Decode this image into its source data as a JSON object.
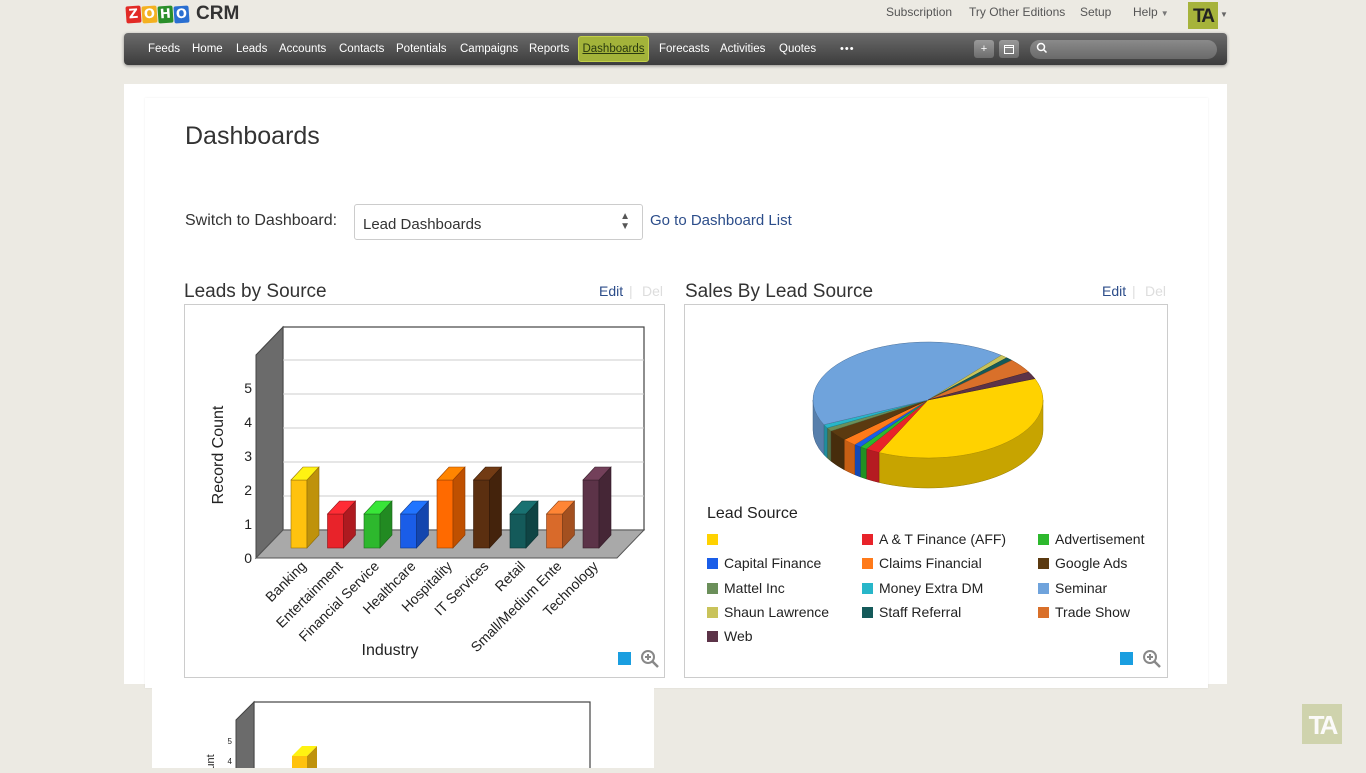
{
  "app": {
    "logo_letters": [
      "Z",
      "O",
      "H",
      "O"
    ],
    "logo_colors": [
      "#e22b26",
      "#f4b120",
      "#2a8f2a",
      "#2a6fd1"
    ],
    "product": "CRM",
    "avatar_initials": "TA"
  },
  "top_links": [
    "Subscription",
    "Try Other Editions",
    "Setup",
    "Help"
  ],
  "nav": {
    "items": [
      "Feeds",
      "Home",
      "Leads",
      "Accounts",
      "Contacts",
      "Potentials",
      "Campaigns",
      "Reports",
      "Dashboards",
      "Forecasts",
      "Activities",
      "Quotes"
    ],
    "active": "Dashboards",
    "more": "•••",
    "add_icon": "+",
    "calendar_icon": "calendar-icon",
    "search_placeholder": ""
  },
  "page": {
    "title": "Dashboards",
    "switch_label": "Switch to Dashboard:",
    "selected_dashboard": "Lead Dashboards",
    "goto_link": "Go to Dashboard List"
  },
  "widgets": [
    {
      "title": "Leads by Source",
      "edit": "Edit",
      "sep": "|",
      "del": "Del"
    },
    {
      "title": "Sales By Lead Source",
      "edit": "Edit",
      "sep": "|",
      "del": "Del"
    }
  ],
  "chart_data": [
    {
      "type": "bar",
      "title": "",
      "xlabel": "Industry",
      "ylabel": "Record Count",
      "categories": [
        "Banking",
        "Entertainment",
        "Financial Service",
        "Healthcare",
        "Hospitality",
        "IT Services",
        "Retail",
        "Small/Medium Ente",
        "Technology"
      ],
      "values": [
        2,
        1,
        1,
        1,
        2,
        2,
        1,
        1,
        2
      ],
      "colors": [
        "#ffc20e",
        "#e8232a",
        "#2db82d",
        "#1a5de8",
        "#ff6a00",
        "#5b2f10",
        "#145a5a",
        "#d96a2a",
        "#5c3348"
      ],
      "ylim": [
        0,
        5
      ],
      "yticks": [
        "0",
        "1",
        "2",
        "3",
        "4",
        "5"
      ],
      "grid": true
    },
    {
      "type": "pie",
      "title": "",
      "legend_title": "Lead Source",
      "legend_placement": "bottom",
      "slices": [
        {
          "label": "",
          "value": 38,
          "color": "#ffd200"
        },
        {
          "label": "A & T Finance (AFF)",
          "value": 2,
          "color": "#e8232a"
        },
        {
          "label": "Advertisement",
          "value": 1,
          "color": "#2db82d"
        },
        {
          "label": "Capital Finance",
          "value": 1,
          "color": "#1a5de8"
        },
        {
          "label": "Claims Financial",
          "value": 2,
          "color": "#ff7a1a"
        },
        {
          "label": "Google Ads",
          "value": 3,
          "color": "#5b3a10"
        },
        {
          "label": "Mattel Inc",
          "value": 1,
          "color": "#6b8f5a"
        },
        {
          "label": "Money Extra DM",
          "value": 1,
          "color": "#28b6c9"
        },
        {
          "label": "Seminar",
          "value": 43,
          "color": "#6fa3dc"
        },
        {
          "label": "Shaun Lawrence",
          "value": 1,
          "color": "#c9c35a"
        },
        {
          "label": "Staff Referral",
          "value": 1,
          "color": "#145a5a"
        },
        {
          "label": "Trade Show",
          "value": 4,
          "color": "#d9702a"
        },
        {
          "label": "Web",
          "value": 2,
          "color": "#5c3348"
        }
      ]
    },
    {
      "type": "bar",
      "title": "",
      "ylabel": "unt",
      "yticks": [
        "4",
        "5"
      ],
      "values": [
        4
      ],
      "ylim": [
        0,
        5
      ],
      "colors": [
        "#ffc20e"
      ]
    }
  ],
  "colors": {
    "nav_active": "#a3b33a",
    "link": "#2c4d8a",
    "accent_blue": "#1a9ee0"
  }
}
